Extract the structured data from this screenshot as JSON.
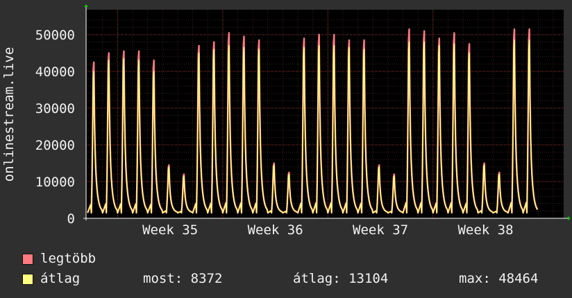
{
  "chart_data": {
    "type": "area",
    "ylabel": "onlinestream.live",
    "ylim": [
      0,
      55000
    ],
    "y_ticks": [
      "0",
      "10000",
      "20000",
      "30000",
      "40000",
      "50000"
    ],
    "x_ticks": [
      "Week 35",
      "Week 36",
      "Week 37",
      "Week 38"
    ],
    "grid": true,
    "series": [
      {
        "name": "legtöbb",
        "color": "#ff7a80",
        "daily_peaks": [
          42500,
          45000,
          45500,
          45500,
          43000,
          14500,
          12000,
          47000,
          48000,
          50500,
          49500,
          48500,
          15000,
          12500,
          49000,
          50000,
          50000,
          48500,
          48500,
          14500,
          12000,
          51500,
          51000,
          49000,
          50500,
          47500,
          15000,
          12500,
          51500,
          51500
        ]
      },
      {
        "name": "átlag",
        "color": "#ffff80",
        "daily_peaks": [
          40000,
          43000,
          43500,
          43000,
          40000,
          14000,
          11500,
          45000,
          46000,
          47000,
          46500,
          46000,
          14500,
          12000,
          46500,
          47000,
          47000,
          46500,
          46000,
          14000,
          11500,
          48000,
          48000,
          47000,
          47500,
          45000,
          14500,
          12000,
          48500,
          48464
        ]
      }
    ]
  },
  "legend": {
    "max_label": "legtöbb",
    "avg_label": "átlag",
    "colors": {
      "max": "#ff7a80",
      "avg": "#ffff80"
    }
  },
  "stats": {
    "now": "most: 8372",
    "avg": "átlag: 13104",
    "max": "max: 48464"
  }
}
